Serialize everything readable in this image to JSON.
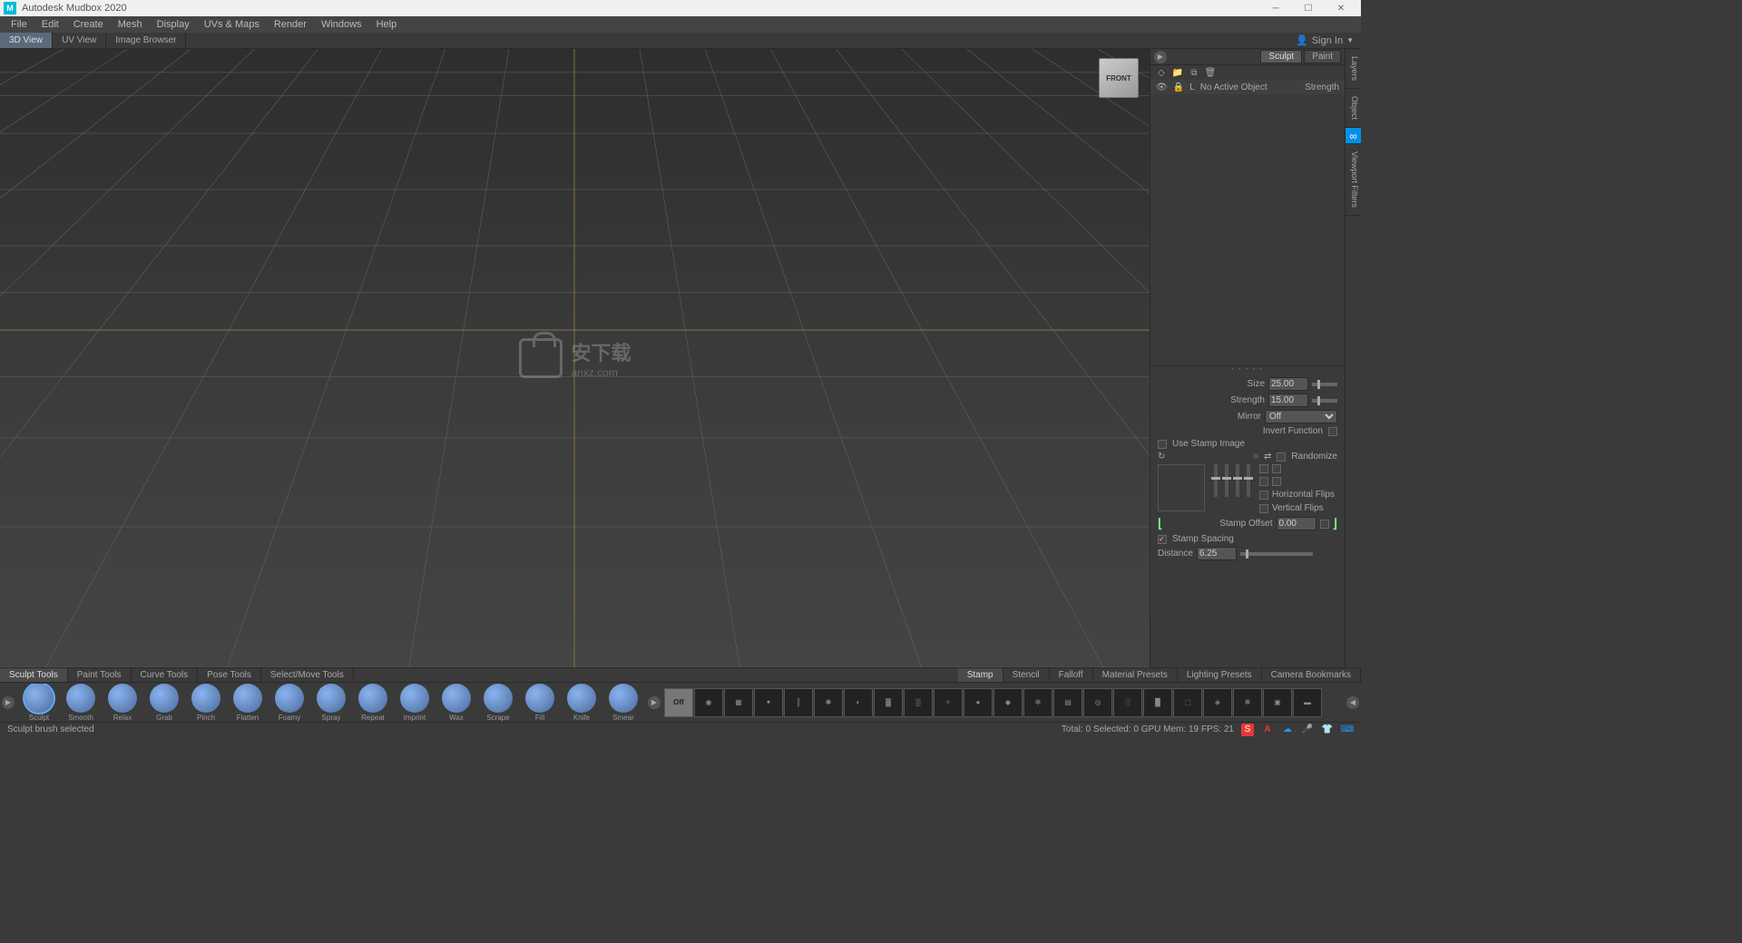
{
  "title": "Autodesk Mudbox 2020",
  "menus": [
    "File",
    "Edit",
    "Create",
    "Mesh",
    "Display",
    "UVs & Maps",
    "Render",
    "Windows",
    "Help"
  ],
  "view_tabs": [
    "3D View",
    "UV View",
    "Image Browser"
  ],
  "active_view_tab": 0,
  "signin": "Sign In",
  "viewcube": "FRONT",
  "watermark": {
    "cn": "安下载",
    "en": "anxz.com"
  },
  "right": {
    "mode_tabs": [
      "Sculpt",
      "Paint"
    ],
    "active_mode": 0,
    "layer_cols": {
      "l": "L",
      "noactive": "No Active Object",
      "strength": "Strength"
    }
  },
  "props": {
    "size_label": "Size",
    "size": "25.00",
    "strength_label": "Strength",
    "strength": "15.00",
    "mirror_label": "Mirror",
    "mirror": "Off",
    "invert": "Invert Function",
    "usestamp": "Use Stamp Image",
    "randomize": "Randomize",
    "hflip": "Horizontal Flips",
    "vflip": "Vertical Flips",
    "stampoffset_label": "Stamp Offset",
    "stampoffset": "0.00",
    "stampspacing": "Stamp Spacing",
    "distance_label": "Distance",
    "distance": "6.25"
  },
  "vtabs": [
    "Layers",
    "Object",
    "Viewport Filters"
  ],
  "tool_cats_left": [
    "Sculpt Tools",
    "Paint Tools",
    "Curve Tools",
    "Pose Tools",
    "Select/Move Tools"
  ],
  "tool_cats_right": [
    "Stamp",
    "Stencil",
    "Falloff",
    "Material Presets",
    "Lighting Presets",
    "Camera Bookmarks"
  ],
  "active_cat_left": 0,
  "active_cat_right": 0,
  "tools": [
    "Sculpt",
    "Smooth",
    "Relax",
    "Grab",
    "Pinch",
    "Flatten",
    "Foamy",
    "Spray",
    "Repeat",
    "Imprint",
    "Wax",
    "Scrape",
    "Fill",
    "Knife",
    "Smear"
  ],
  "active_tool": 0,
  "stamp_off": "Off",
  "status_msg": "Sculpt brush selected",
  "status_right": "Total: 0  Selected: 0 GPU Mem: 19  FPS: 21"
}
